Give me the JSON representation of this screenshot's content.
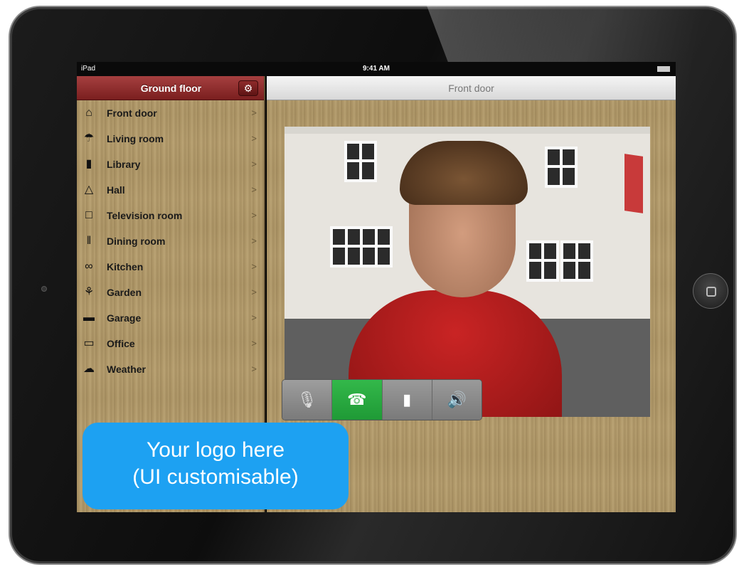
{
  "statusbar": {
    "carrier": "iPad",
    "time": "9:41 AM"
  },
  "sidebar": {
    "title": "Ground floor",
    "settings_icon": "gear-icon",
    "items": [
      {
        "label": "Front door",
        "icon": "house-icon",
        "glyph": "⌂"
      },
      {
        "label": "Living room",
        "icon": "lamp-icon",
        "glyph": "☂"
      },
      {
        "label": "Library",
        "icon": "book-icon",
        "glyph": "▮"
      },
      {
        "label": "Hall",
        "icon": "hanger-icon",
        "glyph": "△"
      },
      {
        "label": "Television room",
        "icon": "tv-icon",
        "glyph": "□"
      },
      {
        "label": "Dining room",
        "icon": "cutlery-icon",
        "glyph": "‖"
      },
      {
        "label": "Kitchen",
        "icon": "glasses-icon",
        "glyph": "∞"
      },
      {
        "label": "Garden",
        "icon": "plant-icon",
        "glyph": "⚘"
      },
      {
        "label": "Garage",
        "icon": "car-icon",
        "glyph": "▬"
      },
      {
        "label": "Office",
        "icon": "monitor-icon",
        "glyph": "▭"
      },
      {
        "label": "Weather",
        "icon": "cloud-icon",
        "glyph": "☁"
      }
    ]
  },
  "main": {
    "title": "Front door"
  },
  "controls": {
    "mute_icon": "microphone-off-icon",
    "call_icon": "phone-icon",
    "door_icon": "door-icon",
    "speaker_icon": "speaker-icon"
  },
  "logo": {
    "line1": "Your logo here",
    "line2": "(UI customisable)"
  },
  "colors": {
    "header_red": "#8e2a2a",
    "call_green": "#2db043",
    "logo_blue": "#1da1f2"
  }
}
